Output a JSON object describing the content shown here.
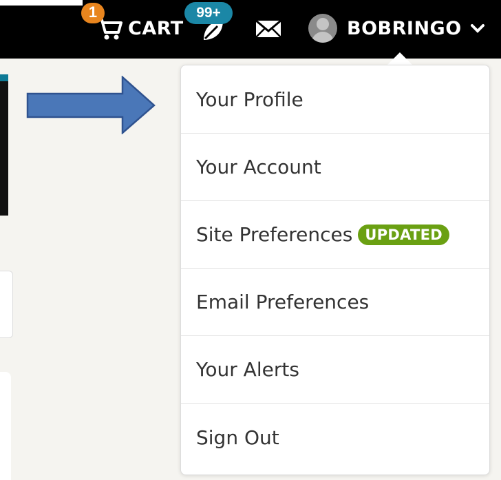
{
  "header": {
    "cart_count": "1",
    "cart_label": "CART",
    "notifications_count": "99+",
    "username": "BOBRINGO"
  },
  "menu": {
    "items": [
      {
        "label": "Your Profile"
      },
      {
        "label": "Your Account"
      },
      {
        "label": "Site Preferences",
        "badge": "UPDATED"
      },
      {
        "label": "Email Preferences"
      },
      {
        "label": "Your Alerts"
      },
      {
        "label": "Sign Out"
      }
    ]
  },
  "icons": [
    "cart-icon",
    "notification-leaf-icon",
    "mail-icon",
    "avatar",
    "chevron-down-icon",
    "arrow-annotation"
  ],
  "colors": {
    "topbar": "#000000",
    "cart_badge": "#e8851e",
    "notif_badge": "#1b87a6",
    "updated_badge": "#6aa012",
    "arrow": "#4a77b8"
  }
}
